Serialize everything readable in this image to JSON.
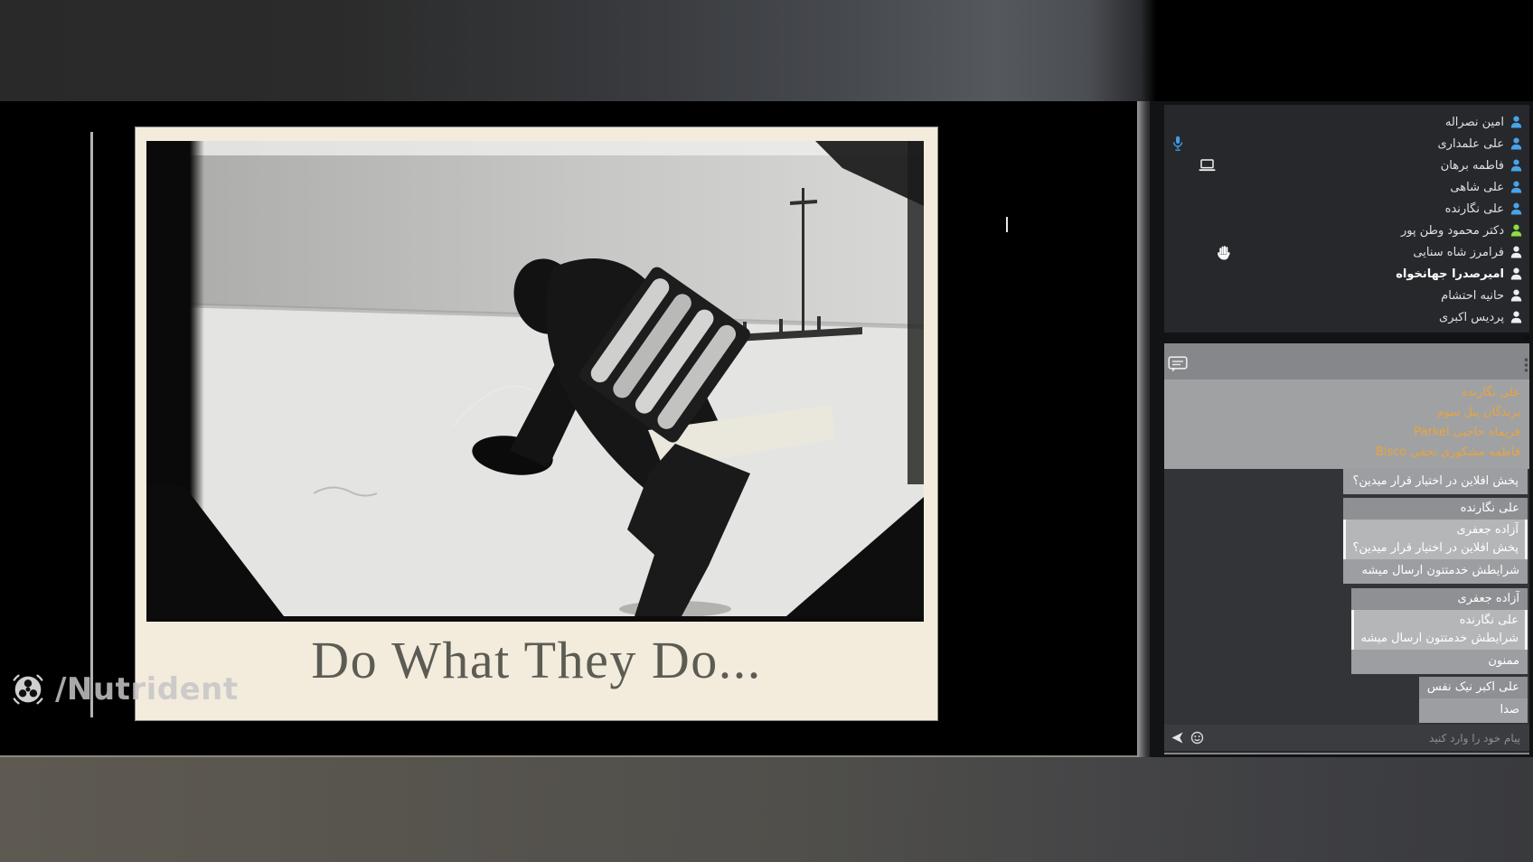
{
  "stage": {
    "slide": {
      "caption": "Do What They Do...",
      "photo_description": "black-and-white film still: man bent forward wearing a rack of cylinder tanks on his back, light wall and floor, camera stand at right"
    },
    "watermark": {
      "brand": "/Nutrident"
    }
  },
  "colors": {
    "accent_blue": "#4aa3e8",
    "presenter_green": "#8fdc43",
    "announcement_orange": "#e9a53e",
    "slide_cream": "#f3ecdc",
    "chat_dark": "#323438",
    "bubble_gray": "#9c9ea1"
  },
  "participants": {
    "items": [
      {
        "name": "امین نصراله",
        "icon_color": "blue"
      },
      {
        "name": "علی علمداری",
        "icon_color": "blue"
      },
      {
        "name": "فاطمه برهان",
        "icon_color": "blue"
      },
      {
        "name": "علی شاهی",
        "icon_color": "blue"
      },
      {
        "name": "علی نگارنده",
        "icon_color": "blue"
      },
      {
        "name": "دکتر محمود وطن پور",
        "icon_color": "green"
      },
      {
        "name": "فرامرز شاه سنایی",
        "icon_color": "white"
      },
      {
        "name": "امیرصدرا جهانخواه",
        "icon_color": "white",
        "bold": true
      },
      {
        "name": "حانیه احتشام",
        "icon_color": "white"
      },
      {
        "name": "پردیس اکبری",
        "icon_color": "white"
      }
    ],
    "status_icons": [
      {
        "type": "microphone-active"
      },
      {
        "type": "screen-share"
      },
      {
        "type": "raised-hand"
      }
    ]
  },
  "chat": {
    "announcement": {
      "sender": "علی نگارنده",
      "lines": [
        "برندگان پنل سوم",
        "فریماه حاجبی Parkel",
        "فاطمه مشکوری نجفی Bisco"
      ]
    },
    "messages": [
      {
        "text": "پخش افلاین در اختیار قرار میدین؟"
      },
      {
        "sender": "علی نگارنده",
        "quote_sender": "آزاده جعفری",
        "quote_text": "پخش افلاین در اختیار قرار میدین؟",
        "text": "شرایطش خدمتتون ارسال میشه"
      },
      {
        "sender": "آزاده جعفری",
        "quote_sender": "علی نگارنده",
        "quote_text": "شرایطش خدمتتون ارسال میشه",
        "text": "ممنون"
      },
      {
        "sender": "علی اکبر نیک نفس",
        "text": "صدا"
      }
    ],
    "input_placeholder": "پیام خود را وارد کنید"
  }
}
